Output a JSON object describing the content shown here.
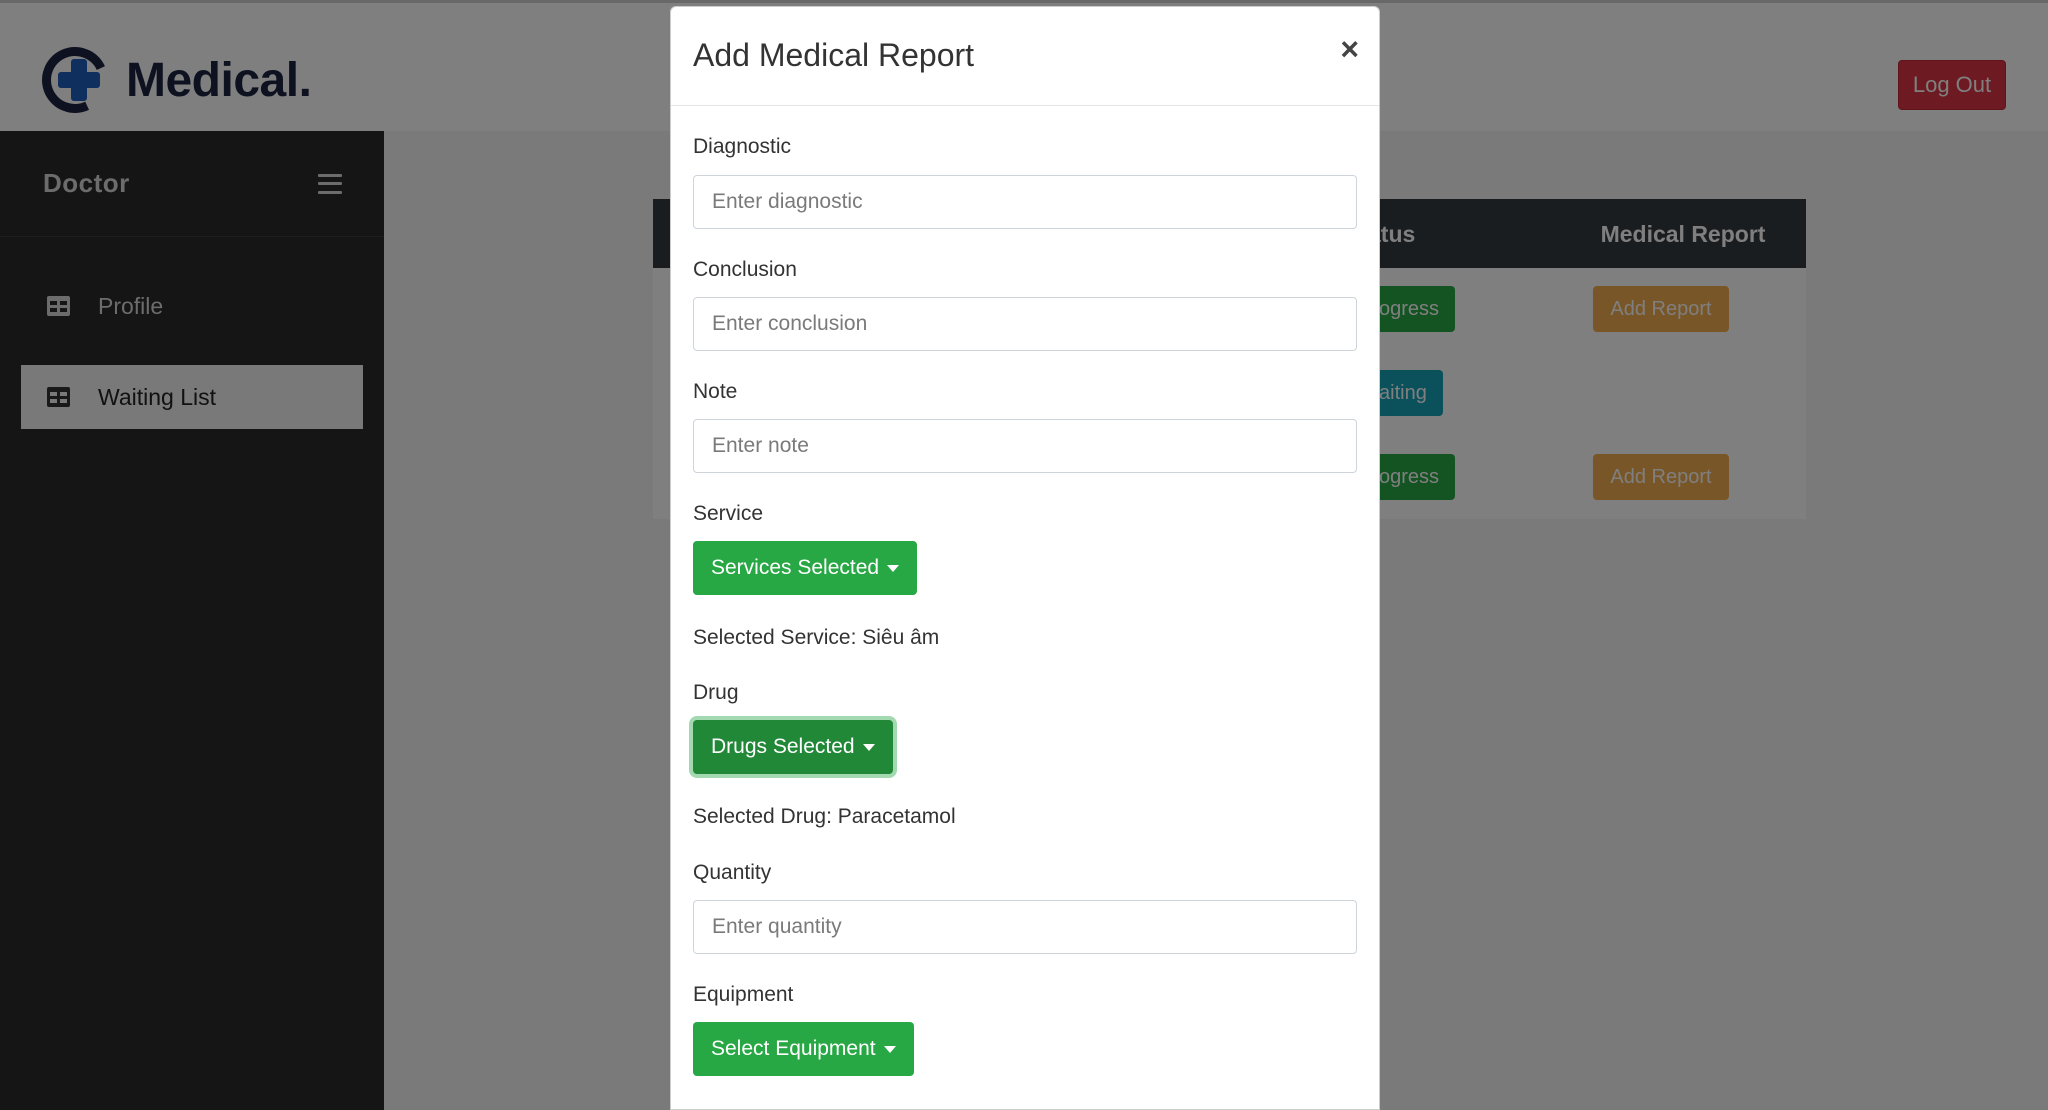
{
  "header": {
    "logo_text": "Medical.",
    "logout_label": "Log Out"
  },
  "sidebar": {
    "title": "Doctor",
    "items": [
      {
        "label": "Profile",
        "icon": "table-icon",
        "active": false
      },
      {
        "label": "Waiting List",
        "icon": "table-icon",
        "active": true
      }
    ]
  },
  "table": {
    "columns": [
      "atus",
      "Medical Report"
    ],
    "rows": [
      {
        "status": "ogress",
        "status_color": "#28a745",
        "action": "Add Report"
      },
      {
        "status": "aiting",
        "status_color": "#17a2b8",
        "action": ""
      },
      {
        "status": "ogress",
        "status_color": "#28a745",
        "action": "Add Report"
      }
    ]
  },
  "modal": {
    "title": "Add Medical Report",
    "close": "×",
    "diagnostic": {
      "label": "Diagnostic",
      "placeholder": "Enter diagnostic",
      "value": ""
    },
    "conclusion": {
      "label": "Conclusion",
      "placeholder": "Enter conclusion",
      "value": ""
    },
    "note": {
      "label": "Note",
      "placeholder": "Enter note",
      "value": ""
    },
    "service": {
      "label": "Service",
      "button": "Services Selected",
      "selected_text": "Selected Service: Siêu âm"
    },
    "drug": {
      "label": "Drug",
      "button": "Drugs Selected",
      "selected_text": "Selected Drug: Paracetamol"
    },
    "quantity": {
      "label": "Quantity",
      "placeholder": "Enter quantity",
      "value": ""
    },
    "equipment": {
      "label": "Equipment",
      "button": "Select Equipment"
    }
  },
  "colors": {
    "sidebar_bg": "#2b2b2b",
    "primary_green": "#28a745",
    "danger": "#dc3545",
    "warning": "#f0ad4e",
    "info": "#17a2b8",
    "table_head": "#343a40"
  }
}
